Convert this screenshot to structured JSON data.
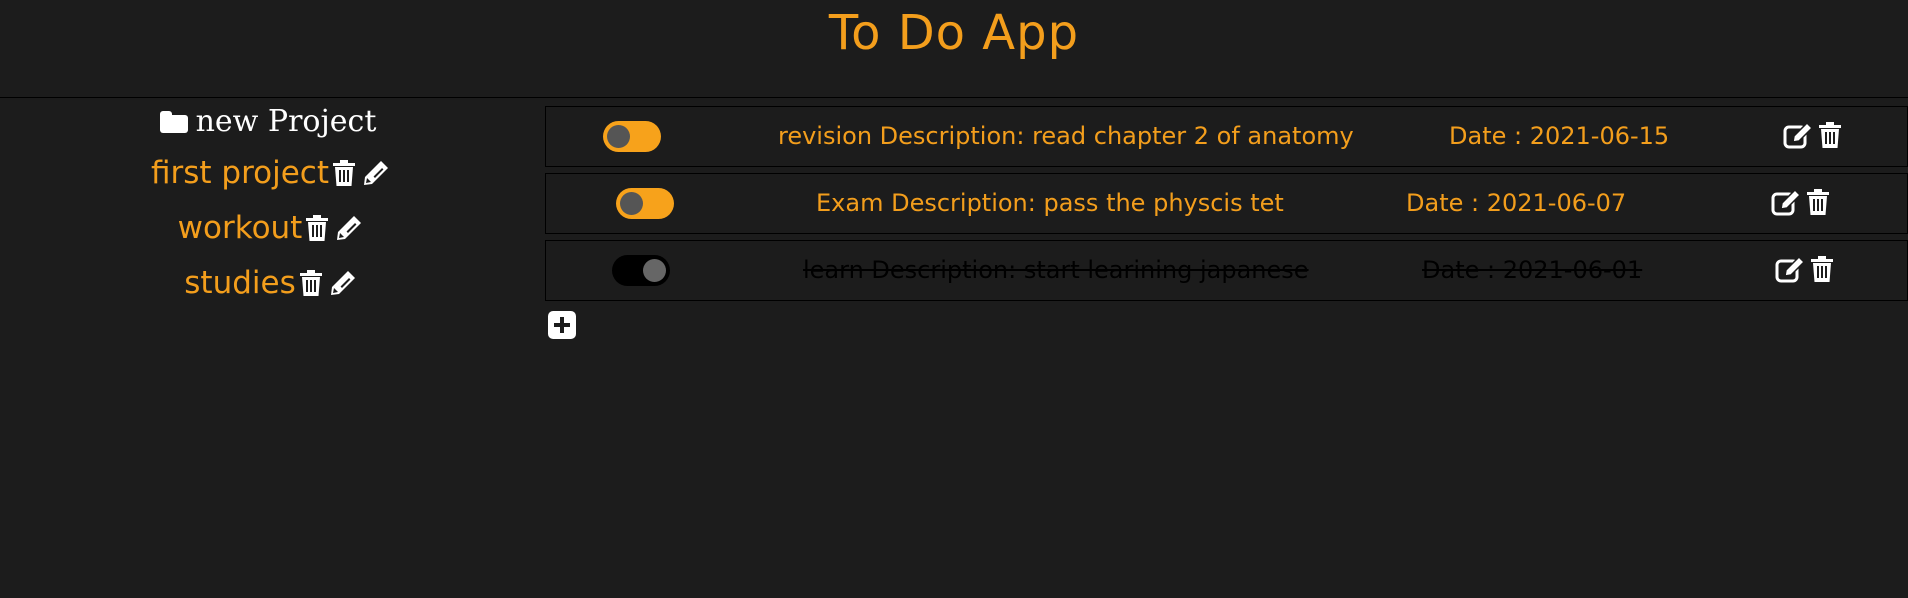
{
  "app": {
    "title": "To Do App"
  },
  "colors": {
    "accent": "#f39e1c",
    "background": "#1c1c1c",
    "icon": "#ffffff"
  },
  "sidebar": {
    "new_project_label": "new Project",
    "new_project_icon": "folder-icon",
    "projects": [
      {
        "name": "first project",
        "icons": [
          "trash-icon",
          "pencil-icon"
        ]
      },
      {
        "name": "workout",
        "icons": [
          "trash-icon",
          "pencil-icon"
        ]
      },
      {
        "name": "studies",
        "icons": [
          "trash-icon",
          "pencil-icon"
        ]
      }
    ]
  },
  "tasks": [
    {
      "title_desc": "revision Description: read chapter 2 of anatomy",
      "date": "Date : 2021-06-15",
      "toggle_on": true,
      "completed": false
    },
    {
      "title_desc": "Exam Description: pass the physcis tet",
      "date": "Date : 2021-06-07",
      "toggle_on": true,
      "completed": false
    },
    {
      "title_desc": "learn Description: start learining japanese",
      "date": "Date : 2021-06-01",
      "toggle_on": false,
      "completed": true
    }
  ],
  "add_task_icon": "plus-square-icon"
}
